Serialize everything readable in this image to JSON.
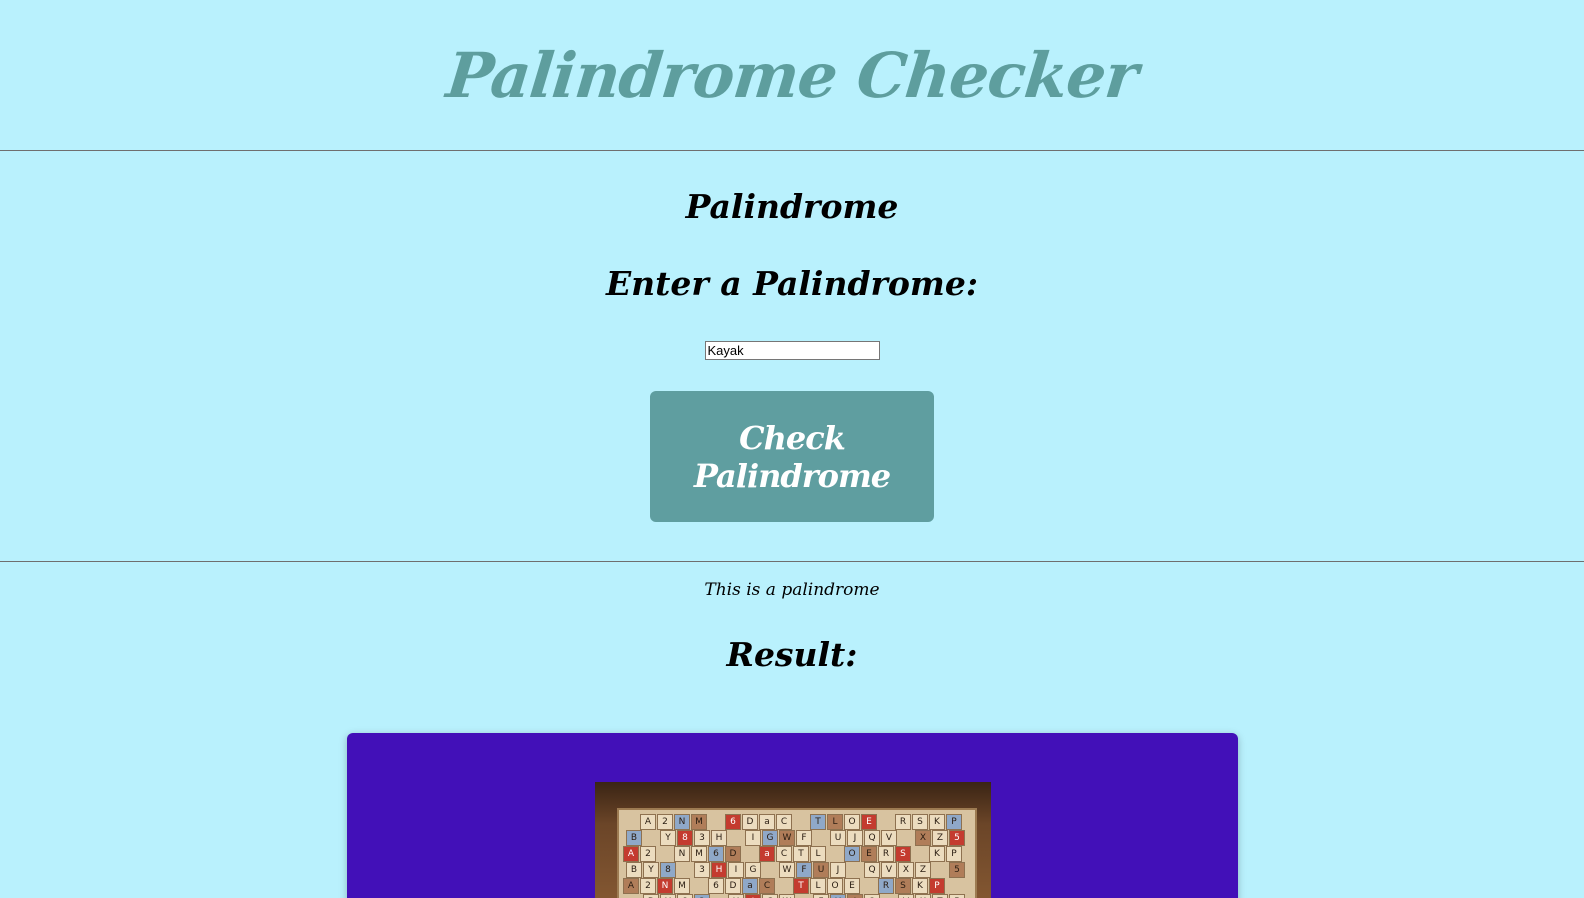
{
  "header": {
    "title": "Palindrome Checker"
  },
  "main": {
    "section_title": "Palindrome",
    "input_label": "Enter a Palindrome:",
    "input_value": "Kayak",
    "button_label": "Check Palindrome"
  },
  "result": {
    "message": "This is a palindrome",
    "title": "Result:",
    "image_tiles": [
      "A",
      "2",
      "N",
      "M",
      "6",
      "D",
      "a",
      "C",
      "T",
      "L",
      "O",
      "E",
      "R",
      "S",
      "K",
      "P",
      "B",
      "Y",
      "8",
      "3",
      "H",
      "I",
      "G",
      "W",
      "F",
      "U",
      "J",
      "Q",
      "V",
      "X",
      "Z",
      "5"
    ]
  },
  "colors": {
    "page_background": "#b9f1fd",
    "title_color": "#5e9e9e",
    "button_background": "#5f9ea0",
    "result_panel": "#4210b8"
  }
}
